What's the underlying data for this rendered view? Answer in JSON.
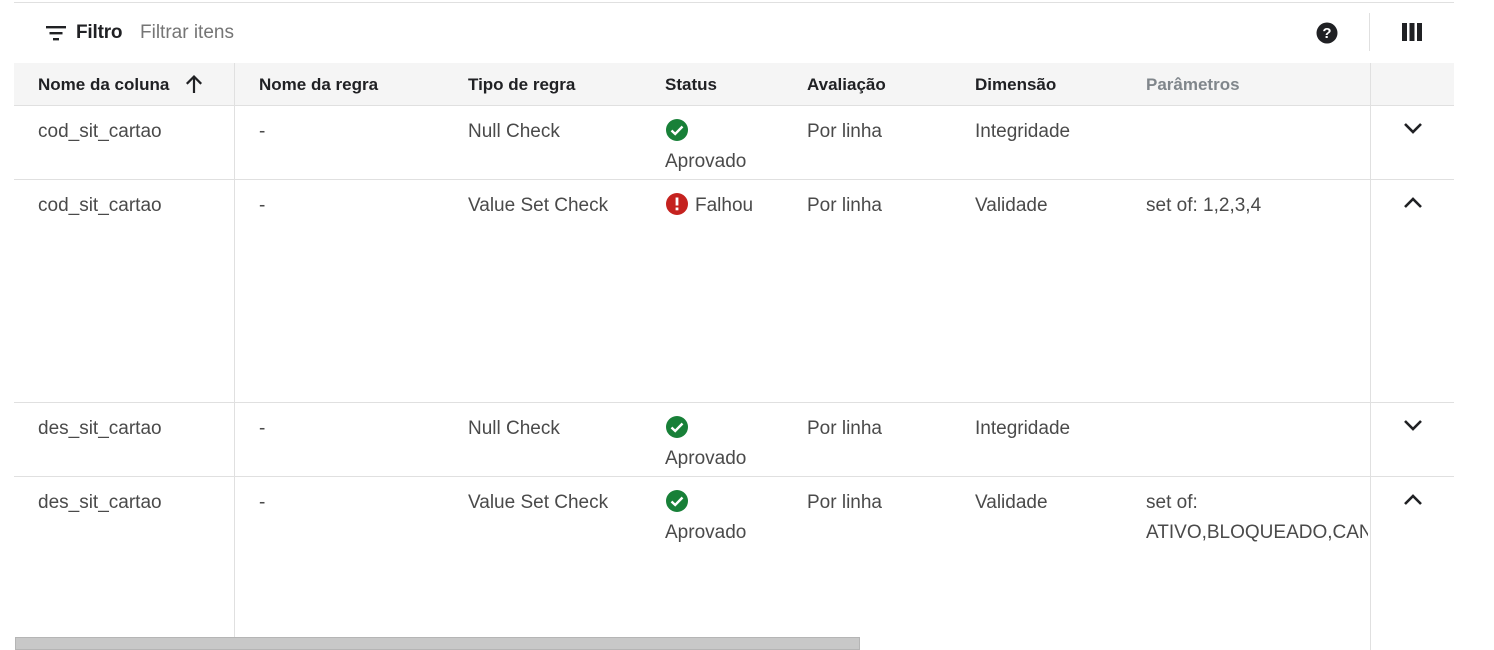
{
  "toolbar": {
    "filter_label": "Filtro",
    "filter_placeholder": "Filtrar itens",
    "filter_icon": "filter-list-icon",
    "help_icon": "help-icon",
    "columns_icon": "view-column-icon"
  },
  "table": {
    "headers": {
      "column_name": "Nome da coluna",
      "rule_name": "Nome da regra",
      "rule_type": "Tipo de regra",
      "status": "Status",
      "evaluation": "Avaliação",
      "dimension": "Dimensão",
      "parameters": "Parâmetros"
    },
    "sort": {
      "column": "Nome da coluna",
      "direction": "ascending",
      "icon": "arrow-upward-icon"
    },
    "rows": [
      {
        "column_name": "cod_sit_cartao",
        "rule_name": "-",
        "rule_type": "Null Check",
        "status": "Aprovado",
        "status_icon": "check-circle-icon",
        "evaluation": "Por linha",
        "dimension": "Integridade",
        "parameters_line1": "",
        "parameters_line2": "",
        "expanded": false
      },
      {
        "column_name": "cod_sit_cartao",
        "rule_name": "-",
        "rule_type": "Value Set Check",
        "status": "Falhou",
        "status_icon": "error-icon",
        "evaluation": "Por linha",
        "dimension": "Validade",
        "parameters_line1": "set of: 1,2,3,4",
        "parameters_line2": "",
        "expanded": true
      },
      {
        "column_name": "des_sit_cartao",
        "rule_name": "-",
        "rule_type": "Null Check",
        "status": "Aprovado",
        "status_icon": "check-circle-icon",
        "evaluation": "Por linha",
        "dimension": "Integridade",
        "parameters_line1": "",
        "parameters_line2": "",
        "expanded": false
      },
      {
        "column_name": "des_sit_cartao",
        "rule_name": "-",
        "rule_type": "Value Set Check",
        "status": "Aprovado",
        "status_icon": "check-circle-icon",
        "evaluation": "Por linha",
        "dimension": "Validade",
        "parameters_line1": "set of:",
        "parameters_line2": "ATIVO,BLOQUEADO,CANC",
        "expanded": true
      }
    ]
  },
  "colors": {
    "success": "#188038",
    "error": "#c5221f",
    "header_bg": "#f5f5f5",
    "divider": "#e0e0e0",
    "muted_text": "#80868b"
  }
}
